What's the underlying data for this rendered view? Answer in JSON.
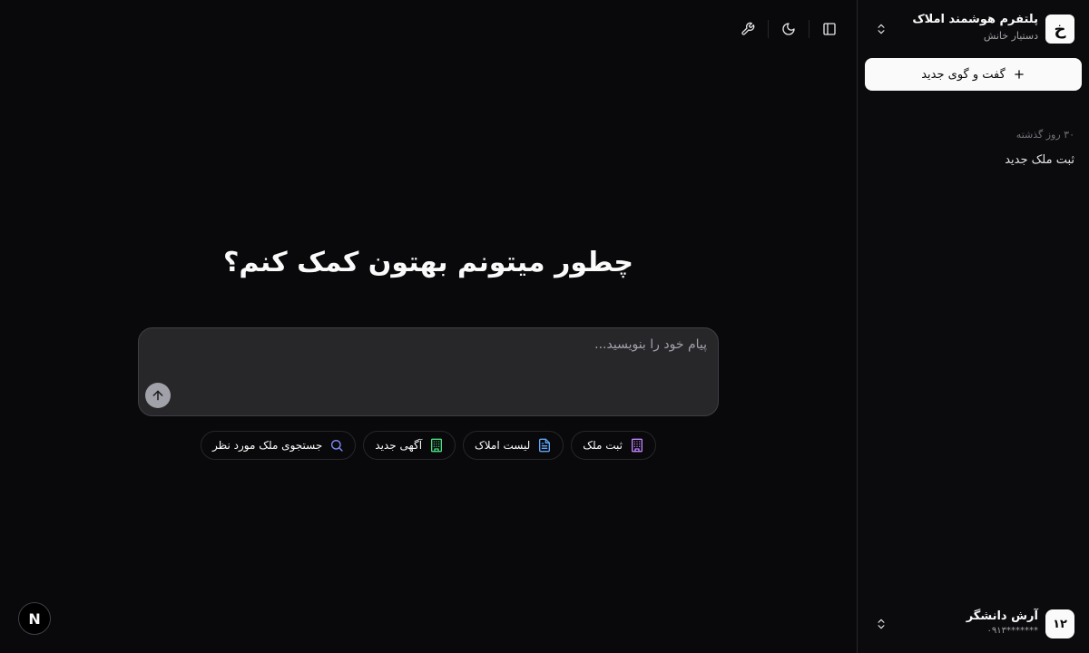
{
  "sidebar": {
    "brand": {
      "logo_text": "خ",
      "title": "پلتفرم هوشمند املاک",
      "subtitle": "دستیار خانش"
    },
    "new_chat_label": "گفت و گوی جدید",
    "history": {
      "heading": "۳۰ روز گذشته",
      "items": [
        {
          "title": "ثبت ملک جدید"
        }
      ]
    },
    "user": {
      "avatar_text": "۱۲",
      "name": "آرش دانشگر",
      "phone": "۰۹۱۳*******"
    }
  },
  "main": {
    "headline": "چطور میتونم بهتون کمک کنم؟",
    "composer": {
      "placeholder": "پیام خود را بنویسید...",
      "value": ""
    },
    "suggestions": [
      {
        "label": "ثبت ملک",
        "icon": "building-icon",
        "color": "#c084fc"
      },
      {
        "label": "لیست املاک",
        "icon": "document-icon",
        "color": "#60a5fa"
      },
      {
        "label": "آگهی جدید",
        "icon": "building-icon",
        "color": "#4ade80"
      },
      {
        "label": "جستجوی ملک مورد نظر",
        "icon": "search-icon",
        "color": "#818cf8"
      }
    ]
  },
  "next_badge": "N",
  "colors": {
    "background": "#09090b",
    "sidebar_border": "#27272a",
    "composer_bg": "#27272a",
    "primary": "#fafafa"
  }
}
